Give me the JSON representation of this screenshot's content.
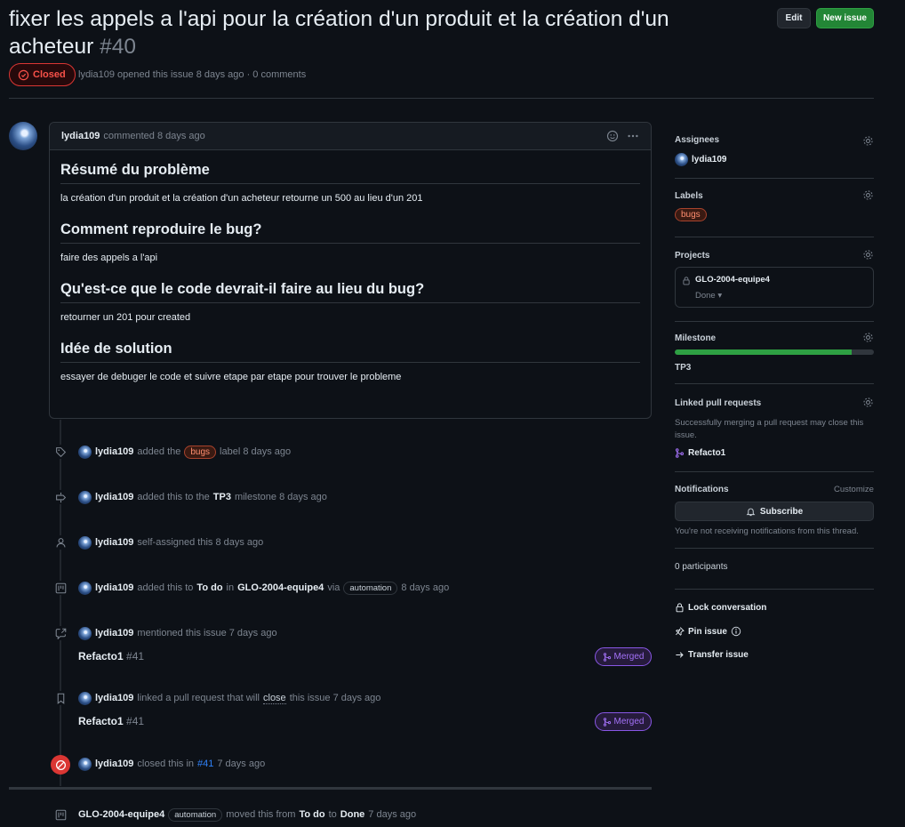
{
  "issue": {
    "title": "fixer les appels a l'api pour la création d'un produit et la création d'un acheteur",
    "number": "#40",
    "state": "Closed",
    "author": "lydia109",
    "opened_text": "opened this issue 8 days ago · 0 comments"
  },
  "header_buttons": {
    "edit": "Edit",
    "new_issue": "New issue"
  },
  "comment": {
    "author": "lydia109",
    "meta": "commented 8 days ago",
    "sections": [
      {
        "heading": "Résumé du problème",
        "text": "la création d'un produit et la création d'un acheteur retourne un 500 au lieu d'un 201"
      },
      {
        "heading": "Comment reproduire le bug?",
        "text": "faire des appels a l'api"
      },
      {
        "heading": "Qu'est-ce que le code devrait-il faire au lieu du bug?",
        "text": "retourner un 201 pour created"
      },
      {
        "heading": "Idée de solution",
        "text": "essayer de debuger le code et suivre etape par etape pour trouver le probleme"
      }
    ]
  },
  "timeline": {
    "e1": {
      "user": "lydia109",
      "pre": "added the",
      "label": "bugs",
      "post": "label 8 days ago",
      "icon": "tag-icon"
    },
    "e2": {
      "user": "lydia109",
      "pre": "added this to the",
      "milestone": "TP3",
      "post": "milestone 8 days ago",
      "icon": "milestone-icon"
    },
    "e3": {
      "user": "lydia109",
      "text": "self-assigned this 8 days ago",
      "icon": "person-icon"
    },
    "e4": {
      "user": "lydia109",
      "pre": "added this to",
      "col": "To do",
      "mid": "in",
      "project": "GLO-2004-equipe4",
      "via": "via",
      "bot": "automation",
      "post": "8 days ago",
      "icon": "project-icon"
    },
    "e5": {
      "user": "lydia109",
      "text": "mentioned this issue 7 days ago",
      "icon": "cross-reference-icon",
      "ref_title": "Refacto1",
      "ref_num": "#41",
      "ref_state": "Merged"
    },
    "e6": {
      "user": "lydia109",
      "pre": "linked a pull request that will",
      "closeword": "close",
      "post": "this issue 7 days ago",
      "icon": "bookmark-icon",
      "ref_title": "Refacto1",
      "ref_num": "#41",
      "ref_state": "Merged"
    },
    "e7": {
      "user": "lydia109",
      "pre": "closed this in",
      "link": "#41",
      "post": "7 days ago",
      "icon": "circle-slash-icon"
    },
    "e8": {
      "actor": "GLO-2004-equipe4",
      "bot": "automation",
      "pre": "moved this from",
      "from": "To do",
      "mid": "to",
      "to": "Done",
      "post": "7 days ago",
      "icon": "project-icon"
    }
  },
  "sidebar": {
    "assignees": {
      "heading": "Assignees",
      "user": "lydia109"
    },
    "labels": {
      "heading": "Labels",
      "label": "bugs"
    },
    "projects": {
      "heading": "Projects",
      "name": "GLO-2004-equipe4",
      "status": "Done"
    },
    "milestone": {
      "heading": "Milestone",
      "name": "TP3",
      "progress": 0.89
    },
    "linked": {
      "heading": "Linked pull requests",
      "desc": "Successfully merging a pull request may close this issue.",
      "pr": "Refacto1"
    },
    "notifications": {
      "heading": "Notifications",
      "customize": "Customize",
      "subscribe": "Subscribe",
      "desc": "You're not receiving notifications from this thread."
    },
    "participants": "0 participants",
    "actions": {
      "lock": "Lock conversation",
      "pin": "Pin issue",
      "transfer": "Transfer issue"
    }
  },
  "colors": {
    "bg": "#0d1117",
    "border": "#30363d",
    "green": "#238636",
    "red": "#da3633",
    "purple": "#a371f7",
    "muted": "#7d8590"
  }
}
